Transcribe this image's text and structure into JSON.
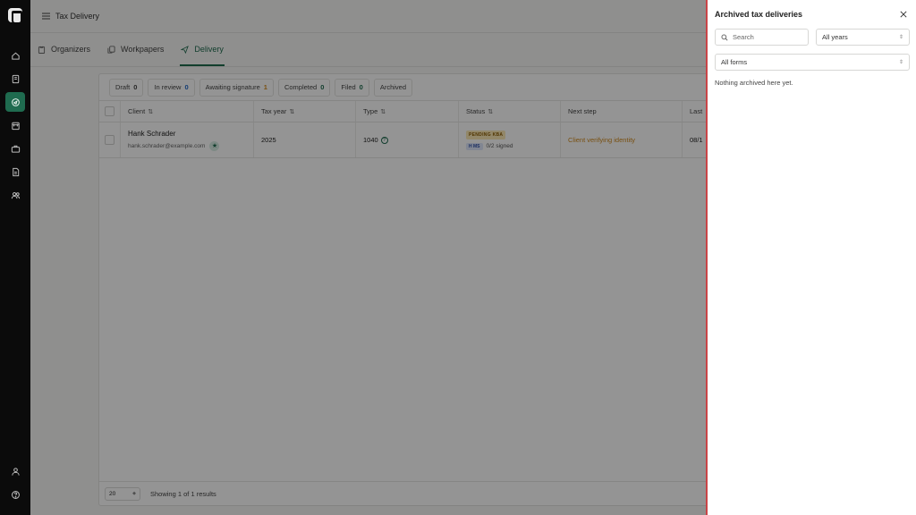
{
  "app": {
    "page_title": "Tax Delivery"
  },
  "nav_tabs": [
    {
      "label": "Organizers"
    },
    {
      "label": "Workpapers"
    },
    {
      "label": "Delivery"
    }
  ],
  "status_tabs": [
    {
      "label": "Draft",
      "count": "0"
    },
    {
      "label": "In review",
      "count": "0"
    },
    {
      "label": "Awaiting signature",
      "count": "1"
    },
    {
      "label": "Completed",
      "count": "0"
    },
    {
      "label": "Filed",
      "count": "0"
    },
    {
      "label": "Archived",
      "count": ""
    }
  ],
  "table": {
    "headers": {
      "client": "Client",
      "tax_year": "Tax year",
      "type": "Type",
      "status": "Status",
      "next_step": "Next step",
      "last": "Last"
    },
    "sort_glyph": "⇅",
    "rows": [
      {
        "client_name": "Hank Schrader",
        "client_email": "hank.schrader@example.com",
        "tax_year": "2025",
        "type": "1040",
        "status_badge": "PENDING KBA",
        "signer_initials": "H MS",
        "signed": "0/2 signed",
        "next_step": "Client verifying identity",
        "last": "08/1"
      }
    ]
  },
  "footer": {
    "page_size": "20",
    "showing": "Showing 1 of 1 results"
  },
  "drawer": {
    "title": "Archived tax deliveries",
    "search_placeholder": "Search",
    "year_filter": "All years",
    "form_filter": "All forms",
    "empty_message": "Nothing archived here yet."
  },
  "icons": {
    "rail": [
      "home-icon",
      "organizer-icon",
      "delivery-icon",
      "calendar-icon",
      "briefcase-icon",
      "document-icon",
      "users-icon",
      "user-icon",
      "help-icon"
    ]
  },
  "colors": {
    "accent": "#1f6b4f",
    "warning": "#d08a1e",
    "drawer_border": "#c94447"
  }
}
